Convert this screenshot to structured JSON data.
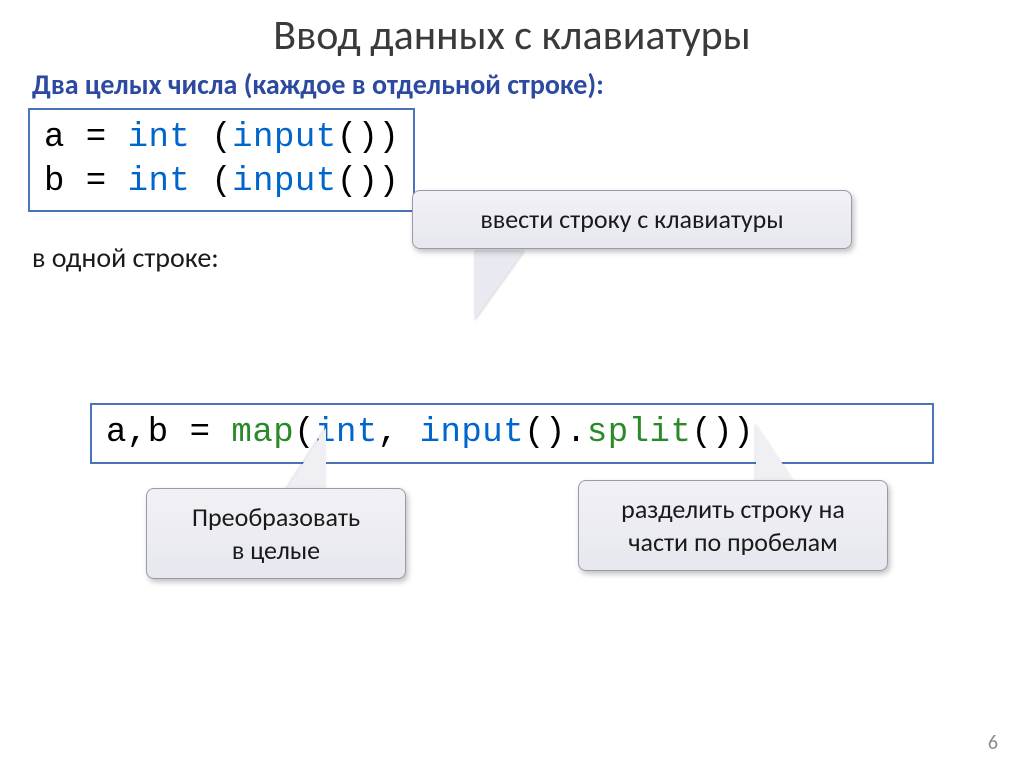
{
  "title": "Ввод данных с клавиатуры",
  "subtitle": "Два целых числа (каждое в отдельной строке):",
  "code_box1": {
    "line1": {
      "var": "a = ",
      "kw": "int",
      "paren_open": " (",
      "fn": "input",
      "paren_close": "())"
    },
    "line2": {
      "var": "b = ",
      "kw": "int",
      "paren_open": " (",
      "fn": "input",
      "paren_close": "())"
    }
  },
  "body_text": "в одной строке:",
  "code_box2": {
    "lead": "a,b = ",
    "map": "map",
    "open": "(",
    "int": "int",
    "comma": ", ",
    "input": "input",
    "mid": "().",
    "split": "split",
    "close": "())"
  },
  "callouts": {
    "c1": "ввести строку с клавиатуры",
    "c2_l1": "Преобразовать",
    "c2_l2": "в целые",
    "c3_l1": "разделить строку на",
    "c3_l2": "части по пробелам"
  },
  "page_number": "6"
}
